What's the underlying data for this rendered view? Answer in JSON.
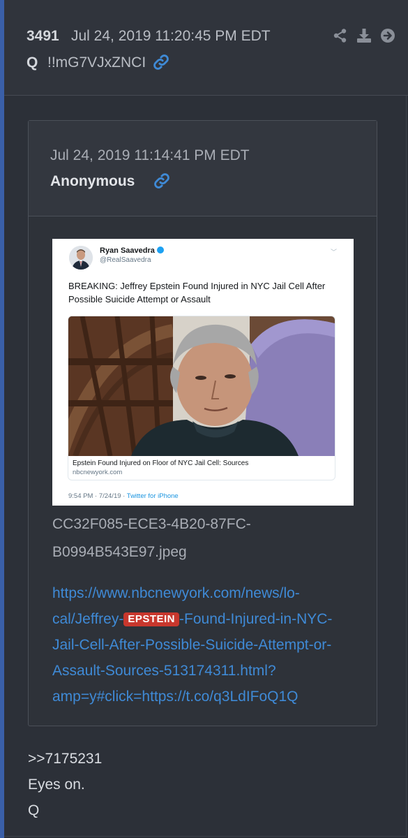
{
  "post": {
    "number": "3491",
    "date": "Jul 24, 2019 11:20:45 PM EDT",
    "author": "Q",
    "tripcode": "!!mG7VJxZNCI",
    "icons": [
      "share-icon",
      "download-icon",
      "arrow-right-icon"
    ]
  },
  "quote": {
    "date": "Jul 24, 2019 11:14:41 PM EDT",
    "name": "Anonymous"
  },
  "tweet": {
    "name": "Ryan Saavedra",
    "handle": "@RealSaavedra",
    "text": "BREAKING: Jeffrey Epstein Found Injured in NYC Jail Cell After Possible Suicide Attempt or Assault",
    "card_title": "Epstein Found Injured on Floor of NYC Jail Cell: Sources",
    "card_domain": "nbcnewyork.com",
    "timestamp": "9:54 PM · 7/24/19 · ",
    "via": "Twitter for iPhone"
  },
  "attachment": {
    "filename_line1": "CC32F085-ECE3-4B20-87FC-",
    "filename_line2": "B0994B543E97.jpeg"
  },
  "link": {
    "line1": "https://www.nbcnewyork.com/news/lo-",
    "line2_pre": "cal/Jeffrey-",
    "tag": "EPSTEIN",
    "line2_post": "-Found-Injured-in-NYC-",
    "line3": "Jail-Cell-After-Possible-Suicide-Attempt-or-",
    "line4": "Assault-Sources-513174311.html?",
    "line5": "amp=y#click=https://t.co/q3LdIFoQ1Q"
  },
  "message": {
    "line1": ">>7175231",
    "line2": "Eyes on.",
    "line3": "Q"
  },
  "colors": {
    "accent": "#3f8ad6",
    "tag": "#c8372d",
    "background": "#2c3038"
  }
}
